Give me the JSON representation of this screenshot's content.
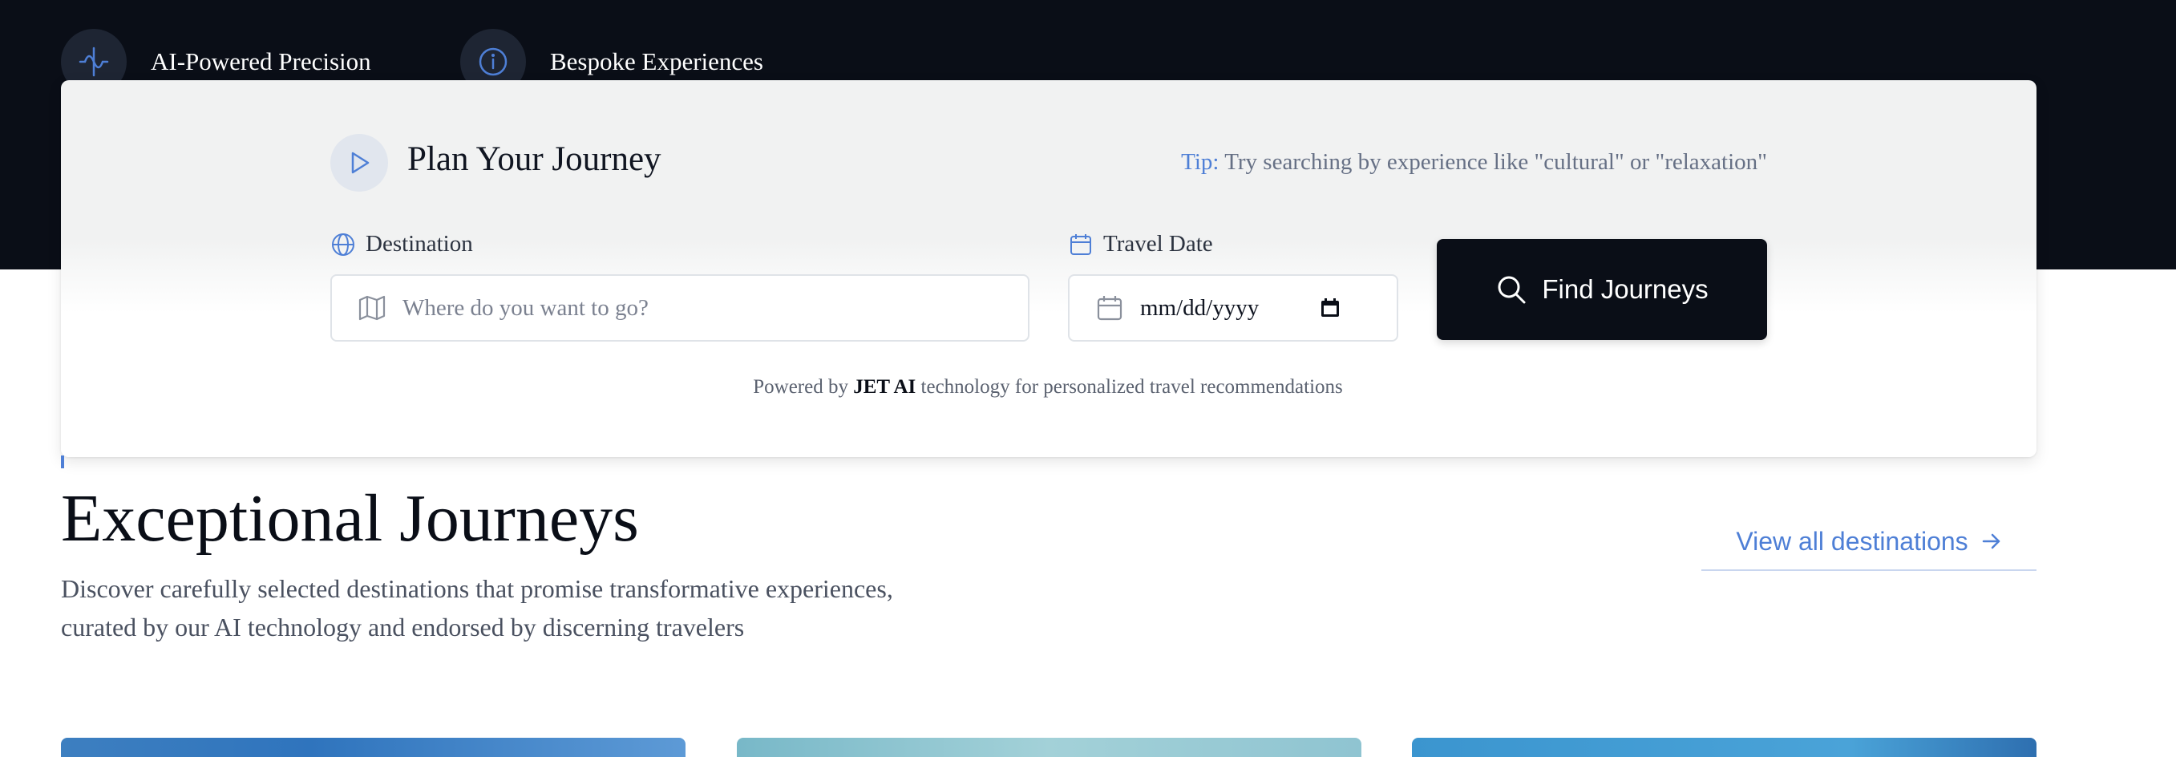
{
  "hero": {
    "features": [
      {
        "label": "AI-Powered Precision",
        "icon": "waveform-icon"
      },
      {
        "label": "Bespoke Experiences",
        "icon": "info-circle-icon"
      }
    ]
  },
  "planner": {
    "title": "Plan Your Journey",
    "tip_label": "Tip:",
    "tip_text": " Try searching by experience like \"cultural\" or \"relaxation\"",
    "destination_label": "Destination",
    "destination_placeholder": "Where do you want to go?",
    "date_label": "Travel Date",
    "date_placeholder": "mm/dd/yyyy",
    "find_button_label": "Find Journeys",
    "powered_prefix": "Powered by ",
    "powered_brand": "JET AI",
    "powered_suffix": " technology for personalized travel recommendations"
  },
  "section": {
    "title": "Exceptional Journeys",
    "description_line1": "Discover carefully selected destinations that promise transformative experiences,",
    "description_line2": "curated by our AI technology and endorsed by discerning travelers",
    "view_all_label": "View all destinations"
  },
  "colors": {
    "accent": "#4e7fd6",
    "dark": "#0a0e17"
  }
}
